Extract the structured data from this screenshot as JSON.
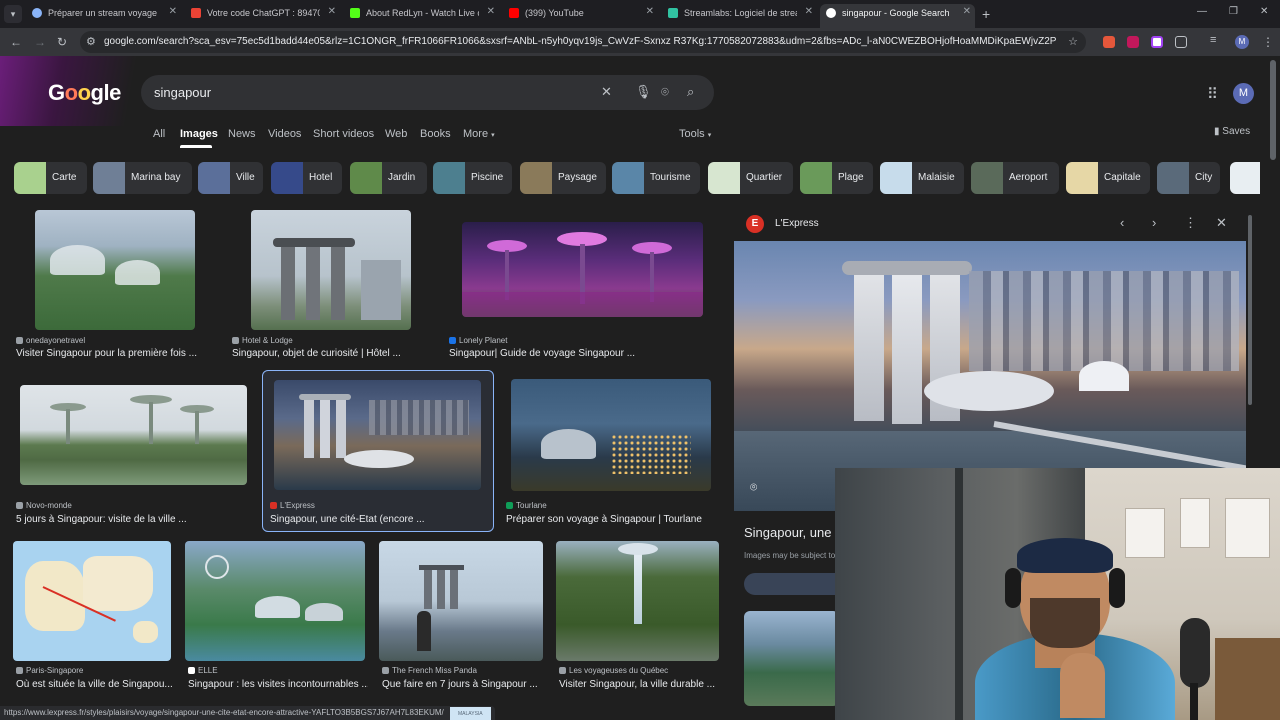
{
  "browser": {
    "tabs": [
      {
        "label": "Préparer un stream voyage",
        "favicon_color": "#8ab4f8"
      },
      {
        "label": "Votre code ChatGPT : 894702 -",
        "favicon_color": "#ea4335"
      },
      {
        "label": "About RedLyn - Watch Live on",
        "favicon_color": "#53fc18"
      },
      {
        "label": "(399) YouTube",
        "favicon_color": "#ff0000"
      },
      {
        "label": "Streamlabs: Logiciel de streami",
        "favicon_color": "#31c3a2"
      },
      {
        "label": "singapour - Google Search",
        "favicon_color": "#ffffff"
      }
    ],
    "url": "google.com/search?sca_esv=75ec5d1badd44e05&rlz=1C1ONGR_frFR1066FR1066&sxsrf=ANbL-n5yh0yqv19js_CwVzF-Sxnxz R37Kg:1770582072883&udm=2&fbs=ADc_l-aN0CWEZBOHjofHoaMMDiKpaEWjvZ2Py1XXV8d8Kvll3ppPER...",
    "profile_initial": "M"
  },
  "google": {
    "query": "singapour",
    "search_tabs": [
      "All",
      "Images",
      "News",
      "Videos",
      "Short videos",
      "Web",
      "Books",
      "More"
    ],
    "active_tab": "Images",
    "tools_label": "Tools",
    "saves_label": "Saves",
    "avatar_initial": "M"
  },
  "chips": [
    {
      "label": "Carte",
      "color": "#a9d18e"
    },
    {
      "label": "Marina bay",
      "color": "#6f7f96"
    },
    {
      "label": "Ville",
      "color": "#5b6f9a"
    },
    {
      "label": "Hotel",
      "color": "#364a8a"
    },
    {
      "label": "Jardin",
      "color": "#5f8a4a"
    },
    {
      "label": "Piscine",
      "color": "#4d7f8f"
    },
    {
      "label": "Paysage",
      "color": "#8a7a5a"
    },
    {
      "label": "Tourisme",
      "color": "#5a86a8"
    },
    {
      "label": "Quartier",
      "color": "#d7e6d0"
    },
    {
      "label": "Plage",
      "color": "#6a9a5a"
    },
    {
      "label": "Malaisie",
      "color": "#c7dceb"
    },
    {
      "label": "Aeroport",
      "color": "#5a6a5a"
    },
    {
      "label": "Capitale",
      "color": "#e6d7a6"
    },
    {
      "label": "City",
      "color": "#5a6a7a"
    }
  ],
  "results": [
    {
      "source": "onedayonetravel",
      "title": "Visiter Singapour pour la première fois ..."
    },
    {
      "source": "Hotel & Lodge",
      "title": "Singapour, objet de curiosité | Hôtel ..."
    },
    {
      "source": "Lonely Planet",
      "title": "Singapour| Guide de voyage Singapour ..."
    },
    {
      "source": "Novo-monde",
      "title": "5 jours à Singapour: visite de la ville ..."
    },
    {
      "source": "L'Express",
      "title": "Singapour, une cité-Etat (encore ..."
    },
    {
      "source": "Tourlane",
      "title": "Préparer son voyage à Singapour | Tourlane"
    },
    {
      "source": "Paris-Singapore",
      "title": "Où est située la ville de Singapou..."
    },
    {
      "source": "ELLE",
      "title": "Singapour : les visites incontournables ..."
    },
    {
      "source": "The French Miss Panda",
      "title": "Que faire en 7 jours à Singapour ..."
    },
    {
      "source": "Les voyageuses du Québec",
      "title": "Visiter Singapour, la ville durable ..."
    }
  ],
  "preview": {
    "source": "L'Express",
    "source_initial": "E",
    "title": "Singapour, une c",
    "note": "Images may be subject to"
  },
  "status_url": "https://www.lexpress.fr/styles/plaisirs/voyage/singapour-une-cite-etat-encore-attractive-YAFLTO3B5BGS7J67AH7L83EKUM/",
  "status_trailing_text": "MALAYSIA"
}
